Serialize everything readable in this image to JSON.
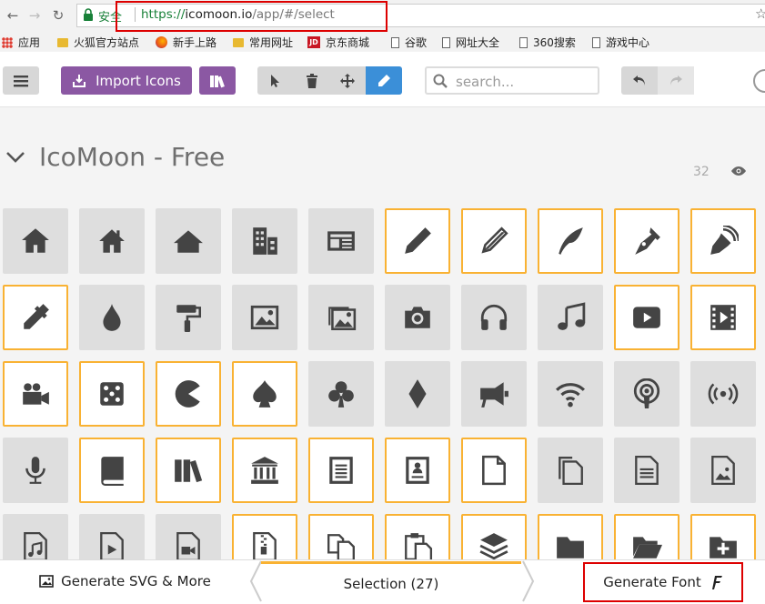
{
  "browser": {
    "secure_label": "安全",
    "url_scheme": "https://",
    "url_host": "icomoon.io",
    "url_path": "/app/#/select",
    "bookmarks": [
      {
        "label": "应用",
        "icon": "apps-grid-icon"
      },
      {
        "label": "火狐官方站点",
        "icon": "folder-icon"
      },
      {
        "label": "新手上路",
        "icon": "firefox-icon"
      },
      {
        "label": "常用网址",
        "icon": "folder-icon"
      },
      {
        "label": "京东商城",
        "icon": "jd-icon"
      },
      {
        "label": "谷歌",
        "icon": "page-icon"
      },
      {
        "label": "网址大全",
        "icon": "page-icon"
      },
      {
        "label": "360搜索",
        "icon": "page-icon"
      },
      {
        "label": "游戏中心",
        "icon": "page-icon"
      }
    ]
  },
  "toolbar": {
    "import_label": "Import Icons",
    "search_placeholder": "search...",
    "accent_purple": "#8b58a3",
    "accent_blue": "#3b8fd8"
  },
  "set": {
    "title": "IcoMoon - Free",
    "count": "32"
  },
  "icons": [
    {
      "name": "home",
      "selected": false
    },
    {
      "name": "home2",
      "selected": false
    },
    {
      "name": "home3",
      "selected": false
    },
    {
      "name": "office",
      "selected": false
    },
    {
      "name": "newspaper",
      "selected": false
    },
    {
      "name": "pencil",
      "selected": true
    },
    {
      "name": "pencil2",
      "selected": true
    },
    {
      "name": "quill",
      "selected": true
    },
    {
      "name": "pen",
      "selected": true
    },
    {
      "name": "blog",
      "selected": true
    },
    {
      "name": "eyedropper",
      "selected": true
    },
    {
      "name": "droplet",
      "selected": false
    },
    {
      "name": "paint-format",
      "selected": false
    },
    {
      "name": "image",
      "selected": false
    },
    {
      "name": "images",
      "selected": false
    },
    {
      "name": "camera",
      "selected": false
    },
    {
      "name": "headphones",
      "selected": false
    },
    {
      "name": "music",
      "selected": false
    },
    {
      "name": "play",
      "selected": true
    },
    {
      "name": "film",
      "selected": true
    },
    {
      "name": "video-camera",
      "selected": true
    },
    {
      "name": "dice",
      "selected": true
    },
    {
      "name": "pacman",
      "selected": true
    },
    {
      "name": "spades",
      "selected": true
    },
    {
      "name": "clubs",
      "selected": false
    },
    {
      "name": "diamonds",
      "selected": false
    },
    {
      "name": "bullhorn",
      "selected": false
    },
    {
      "name": "connection",
      "selected": false
    },
    {
      "name": "podcast",
      "selected": false
    },
    {
      "name": "feed",
      "selected": false
    },
    {
      "name": "mic",
      "selected": false
    },
    {
      "name": "book",
      "selected": true
    },
    {
      "name": "books",
      "selected": true
    },
    {
      "name": "library",
      "selected": true
    },
    {
      "name": "file-text",
      "selected": true
    },
    {
      "name": "profile",
      "selected": true
    },
    {
      "name": "file-empty",
      "selected": true
    },
    {
      "name": "files-empty",
      "selected": false
    },
    {
      "name": "file-text2",
      "selected": false
    },
    {
      "name": "file-picture",
      "selected": false
    },
    {
      "name": "file-music",
      "selected": false
    },
    {
      "name": "file-play",
      "selected": false
    },
    {
      "name": "file-video",
      "selected": false
    },
    {
      "name": "file-zip",
      "selected": true
    },
    {
      "name": "copy",
      "selected": true
    },
    {
      "name": "paste",
      "selected": true
    },
    {
      "name": "stack",
      "selected": true
    },
    {
      "name": "folder",
      "selected": true
    },
    {
      "name": "folder-open",
      "selected": true
    },
    {
      "name": "folder-plus",
      "selected": true
    }
  ],
  "footer": {
    "generate_svg_label": "Generate SVG & More",
    "selection_label": "Selection (27)",
    "generate_font_label": "Generate Font"
  }
}
